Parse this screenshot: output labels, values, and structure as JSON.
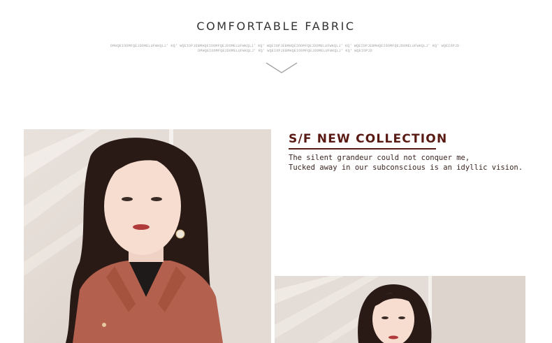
{
  "header": {
    "title": "COMFORTABLE FABRIC",
    "tagline_line1": "DMHQEIOOMFQEJDOMELUFWKQLJ' KQ' WQEIOPJEBMHQEIOOMFQEJDOMELUFWKQLJ' KQ' WQEIOPJEBMHQEIOOMFQEJDOMELUFWKQLJ' KQ' WQEIOPJEBMHQEIOOMFQEJDOMELUFWKQLJ' KQ' WQEIOPJD",
    "tagline_line2": "DMHQEIOOMFQEJDOMELUFWKQLJ' KQ' WQEIOPJEBMHQEIOOMFQEJDOMELUFWKQLJ' KQ' WQEIOPJD"
  },
  "collection": {
    "heading": "S/F NEW COLLECTION",
    "line1": "The silent grandeur could not conquer me,",
    "line2": "Tucked away in our subconscious is an idyllic vision.",
    "accent_color": "#5a1a14"
  },
  "icons": {
    "chevron": "chevron-down-icon"
  },
  "colors": {
    "coat": "#b4604f",
    "wall": "#e6ddd6",
    "hair": "#2a1a16"
  }
}
